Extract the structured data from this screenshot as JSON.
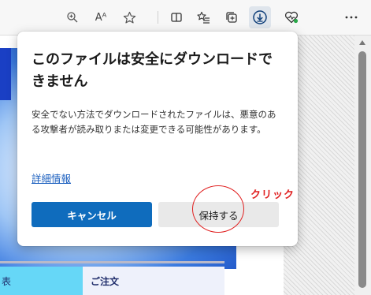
{
  "toolbar": {
    "read_aloud_label": "Aᴬ",
    "icons": [
      "zoom-icon",
      "read-aloud-icon",
      "favorite-star-icon",
      "split-screen-icon",
      "favorites-list-icon",
      "collections-icon",
      "downloads-icon",
      "browser-essentials-icon",
      "more-icon"
    ]
  },
  "dialog": {
    "title": "このファイルは安全にダウンロードできません",
    "body": "安全でない方法でダウンロードされたファイルは、悪意のある攻撃者が読み取りまたは変更できる可能性があります。",
    "link": "詳細情報",
    "cancel_label": "キャンセル",
    "keep_label": "保持する"
  },
  "annotation": {
    "click_label": "クリック",
    "color": "#e02020"
  },
  "page": {
    "tab_left_label": "表",
    "tab_mid_label": "ご注文"
  },
  "colors": {
    "primary_button": "#0f6cbd",
    "link": "#1b5fbf"
  }
}
